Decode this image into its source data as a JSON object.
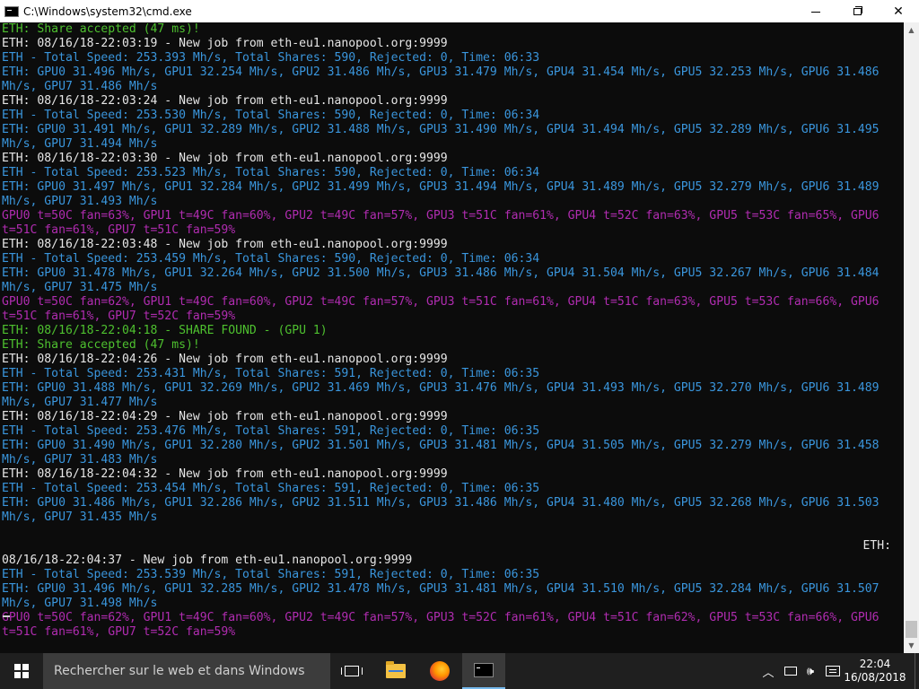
{
  "window": {
    "title": "C:\\Windows\\system32\\cmd.exe",
    "icon": "cmd-icon",
    "controls": {
      "minimize": "minimize",
      "maximize": "maximize",
      "close": "✕"
    }
  },
  "console": {
    "lines": [
      {
        "text": "ETH: Share accepted (47 ms)!",
        "color": "green"
      },
      {
        "text": "ETH: 08/16/18-22:03:19 - New job from eth-eu1.nanopool.org:9999",
        "color": "white"
      },
      {
        "text": "ETH - Total Speed: 253.393 Mh/s, Total Shares: 590, Rejected: 0, Time: 06:33",
        "color": "cyan"
      },
      {
        "text": "ETH: GPU0 31.496 Mh/s, GPU1 32.254 Mh/s, GPU2 31.486 Mh/s, GPU3 31.479 Mh/s, GPU4 31.454 Mh/s, GPU5 32.253 Mh/s, GPU6 31.486",
        "color": "cyan"
      },
      {
        "text": "Mh/s, GPU7 31.486 Mh/s",
        "color": "cyan"
      },
      {
        "text": "ETH: 08/16/18-22:03:24 - New job from eth-eu1.nanopool.org:9999",
        "color": "white"
      },
      {
        "text": "ETH - Total Speed: 253.530 Mh/s, Total Shares: 590, Rejected: 0, Time: 06:34",
        "color": "cyan"
      },
      {
        "text": "ETH: GPU0 31.491 Mh/s, GPU1 32.289 Mh/s, GPU2 31.488 Mh/s, GPU3 31.490 Mh/s, GPU4 31.494 Mh/s, GPU5 32.289 Mh/s, GPU6 31.495",
        "color": "cyan"
      },
      {
        "text": "Mh/s, GPU7 31.494 Mh/s",
        "color": "cyan"
      },
      {
        "text": "ETH: 08/16/18-22:03:30 - New job from eth-eu1.nanopool.org:9999",
        "color": "white"
      },
      {
        "text": "ETH - Total Speed: 253.523 Mh/s, Total Shares: 590, Rejected: 0, Time: 06:34",
        "color": "cyan"
      },
      {
        "text": "ETH: GPU0 31.497 Mh/s, GPU1 32.284 Mh/s, GPU2 31.499 Mh/s, GPU3 31.494 Mh/s, GPU4 31.489 Mh/s, GPU5 32.279 Mh/s, GPU6 31.489",
        "color": "cyan"
      },
      {
        "text": "Mh/s, GPU7 31.493 Mh/s",
        "color": "cyan"
      },
      {
        "text": "GPU0 t=50C fan=63%, GPU1 t=49C fan=60%, GPU2 t=49C fan=57%, GPU3 t=51C fan=61%, GPU4 t=52C fan=63%, GPU5 t=53C fan=65%, GPU6",
        "color": "purple"
      },
      {
        "text": "t=51C fan=61%, GPU7 t=51C fan=59%",
        "color": "purple"
      },
      {
        "text": "ETH: 08/16/18-22:03:48 - New job from eth-eu1.nanopool.org:9999",
        "color": "white"
      },
      {
        "text": "ETH - Total Speed: 253.459 Mh/s, Total Shares: 590, Rejected: 0, Time: 06:34",
        "color": "cyan"
      },
      {
        "text": "ETH: GPU0 31.478 Mh/s, GPU1 32.264 Mh/s, GPU2 31.500 Mh/s, GPU3 31.486 Mh/s, GPU4 31.504 Mh/s, GPU5 32.267 Mh/s, GPU6 31.484",
        "color": "cyan"
      },
      {
        "text": "Mh/s, GPU7 31.475 Mh/s",
        "color": "cyan"
      },
      {
        "text": "GPU0 t=50C fan=62%, GPU1 t=49C fan=60%, GPU2 t=49C fan=57%, GPU3 t=51C fan=61%, GPU4 t=51C fan=63%, GPU5 t=53C fan=66%, GPU6",
        "color": "purple"
      },
      {
        "text": "t=51C fan=61%, GPU7 t=52C fan=59%",
        "color": "purple"
      },
      {
        "text": "ETH: 08/16/18-22:04:18 - SHARE FOUND - (GPU 1)",
        "color": "green"
      },
      {
        "text": "ETH: Share accepted (47 ms)!",
        "color": "green"
      },
      {
        "text": "ETH: 08/16/18-22:04:26 - New job from eth-eu1.nanopool.org:9999",
        "color": "white"
      },
      {
        "text": "ETH - Total Speed: 253.431 Mh/s, Total Shares: 591, Rejected: 0, Time: 06:35",
        "color": "cyan"
      },
      {
        "text": "ETH: GPU0 31.488 Mh/s, GPU1 32.269 Mh/s, GPU2 31.469 Mh/s, GPU3 31.476 Mh/s, GPU4 31.493 Mh/s, GPU5 32.270 Mh/s, GPU6 31.489",
        "color": "cyan"
      },
      {
        "text": "Mh/s, GPU7 31.477 Mh/s",
        "color": "cyan"
      },
      {
        "text": "ETH: 08/16/18-22:04:29 - New job from eth-eu1.nanopool.org:9999",
        "color": "white"
      },
      {
        "text": "ETH - Total Speed: 253.476 Mh/s, Total Shares: 591, Rejected: 0, Time: 06:35",
        "color": "cyan"
      },
      {
        "text": "ETH: GPU0 31.490 Mh/s, GPU1 32.280 Mh/s, GPU2 31.501 Mh/s, GPU3 31.481 Mh/s, GPU4 31.505 Mh/s, GPU5 32.279 Mh/s, GPU6 31.458",
        "color": "cyan"
      },
      {
        "text": "Mh/s, GPU7 31.483 Mh/s",
        "color": "cyan"
      },
      {
        "text": "ETH: 08/16/18-22:04:32 - New job from eth-eu1.nanopool.org:9999",
        "color": "white"
      },
      {
        "text": "ETH - Total Speed: 253.454 Mh/s, Total Shares: 591, Rejected: 0, Time: 06:35",
        "color": "cyan"
      },
      {
        "text": "ETH: GPU0 31.486 Mh/s, GPU1 32.286 Mh/s, GPU2 31.511 Mh/s, GPU3 31.486 Mh/s, GPU4 31.480 Mh/s, GPU5 32.268 Mh/s, GPU6 31.503",
        "color": "cyan"
      },
      {
        "text": "Mh/s, GPU7 31.435 Mh/s",
        "color": "cyan"
      },
      {
        "text": "",
        "color": "white"
      },
      {
        "text": "ETH:",
        "color": "white",
        "align": "right"
      },
      {
        "text": "08/16/18-22:04:37 - New job from eth-eu1.nanopool.org:9999",
        "color": "white"
      },
      {
        "text": "ETH - Total Speed: 253.539 Mh/s, Total Shares: 591, Rejected: 0, Time: 06:35",
        "color": "cyan"
      },
      {
        "text": "ETH: GPU0 31.496 Mh/s, GPU1 32.285 Mh/s, GPU2 31.478 Mh/s, GPU3 31.481 Mh/s, GPU4 31.510 Mh/s, GPU5 32.284 Mh/s, GPU6 31.507",
        "color": "cyan"
      },
      {
        "text": "Mh/s, GPU7 31.498 Mh/s",
        "color": "cyan"
      },
      {
        "text": "GPU0 t=50C fan=62%, GPU1 t=49C fan=60%, GPU2 t=49C fan=57%, GPU3 t=52C fan=61%, GPU4 t=51C fan=62%, GPU5 t=53C fan=66%, GPU6",
        "color": "purple"
      },
      {
        "text": "t=51C fan=61%, GPU7 t=52C fan=59%",
        "color": "purple"
      }
    ]
  },
  "colors": {
    "white": "#e6e6e6",
    "cyan": "#3a96dd",
    "green": "#4ec12f",
    "purple": "#b02cb0"
  },
  "taskbar": {
    "search_placeholder": "Rechercher sur le web et dans Windows",
    "apps": [
      "task-view",
      "file-explorer",
      "firefox",
      "cmd"
    ],
    "clock_time": "22:04",
    "clock_date": "16/08/2018"
  }
}
